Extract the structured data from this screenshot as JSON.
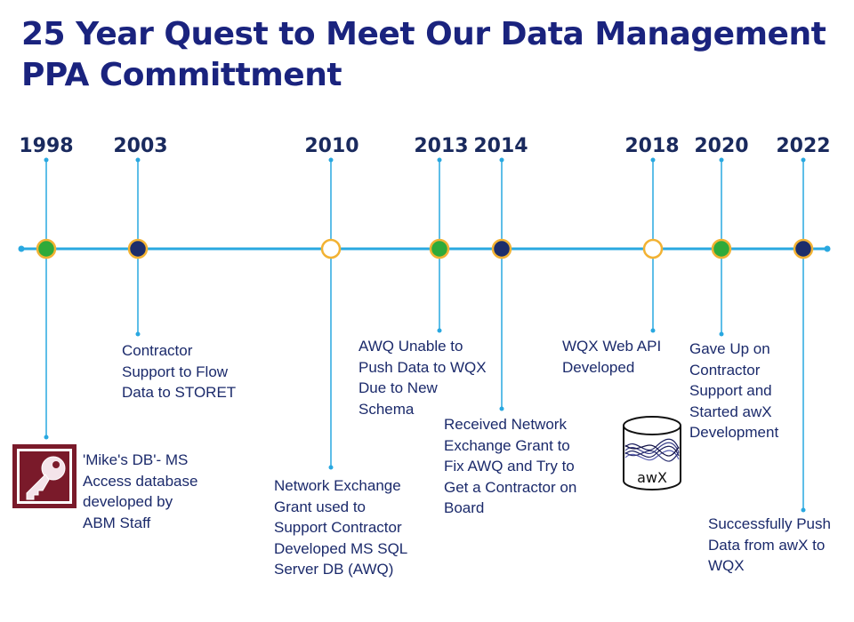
{
  "title": {
    "line1": "25 Year Quest to Meet Our Data Management",
    "line2": "PPA Committment"
  },
  "colors": {
    "title": "#1a237e",
    "axis": "#29a8e0",
    "green_node": "#2eaa3a",
    "navy_node": "#1c2d6b",
    "white_node": "#ffffff",
    "node_ring": "#f2b233",
    "access_icon": "#7a1a2a"
  },
  "milestones": [
    {
      "year": "1998",
      "node": "green",
      "lines": [
        "'Mike's DB'- MS",
        "Access database",
        "developed by",
        "ABM Staff"
      ],
      "icon": "ms-access-icon"
    },
    {
      "year": "2003",
      "node": "navy",
      "lines": [
        "Contractor",
        "Support to Flow",
        "Data to STORET"
      ]
    },
    {
      "year": "2010",
      "node": "white",
      "lines": [
        "Network Exchange",
        "Grant used to",
        "Support  Contractor",
        "Developed MS SQL",
        "Server DB (AWQ)"
      ]
    },
    {
      "year": "2013",
      "node": "green",
      "lines": [
        "AWQ Unable to",
        "Push Data to WQX",
        "Due to New",
        "Schema"
      ]
    },
    {
      "year": "2014",
      "node": "navy",
      "lines": [
        "Received Network",
        "Exchange Grant to",
        "Fix AWQ and Try to",
        "Get a Contractor on",
        "Board"
      ]
    },
    {
      "year": "2018",
      "node": "white",
      "lines": [
        "WQX Web API",
        "Developed"
      ],
      "icon": "awx-database-icon",
      "icon_label": "awX"
    },
    {
      "year": "2020",
      "node": "green",
      "lines": [
        "Gave Up on",
        "Contractor",
        "Support  and",
        "Started awX",
        "Development"
      ]
    },
    {
      "year": "2022",
      "node": "navy",
      "lines": [
        "Successfully Push",
        "Data from awX to",
        "WQX"
      ]
    }
  ]
}
